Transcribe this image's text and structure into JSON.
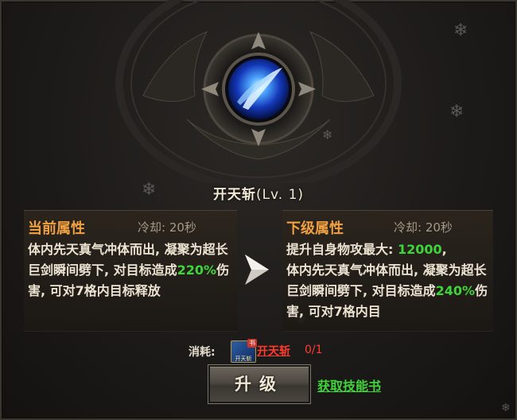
{
  "skill": {
    "name": "开天斩",
    "level_text": "(Lv. 1)",
    "icon": "blue-slash-orb-icon"
  },
  "current": {
    "heading": "当前属性",
    "cooldown": "冷却: 20秒",
    "desc_before": "体内先天真气冲体而出, 凝聚为超长巨剑瞬间劈下, 对目标造成",
    "damage": "220%",
    "desc_after": "伤害, 可对7格内目标释放"
  },
  "next": {
    "heading": "下级属性",
    "cooldown": "冷却: 20秒",
    "bonus_label": "提升自身物攻最大: ",
    "bonus_value": "12000",
    "bonus_suffix": ",",
    "desc_before": "体内先天真气冲体而出, 凝聚为超长巨剑瞬间劈下, 对目标造成",
    "damage": "240%",
    "desc_after": "伤害, 可对7格内目"
  },
  "consume": {
    "label": "消耗:",
    "item_name": "开天斩",
    "item_tag": "书",
    "item_icon_text": "开天斩",
    "count": "0/1"
  },
  "actions": {
    "upgrade_label": "升级",
    "get_book_label": "获取技能书"
  },
  "colors": {
    "heading": "#f0a040",
    "highlight": "#3fd43a",
    "missing": "#ff3b2e"
  }
}
